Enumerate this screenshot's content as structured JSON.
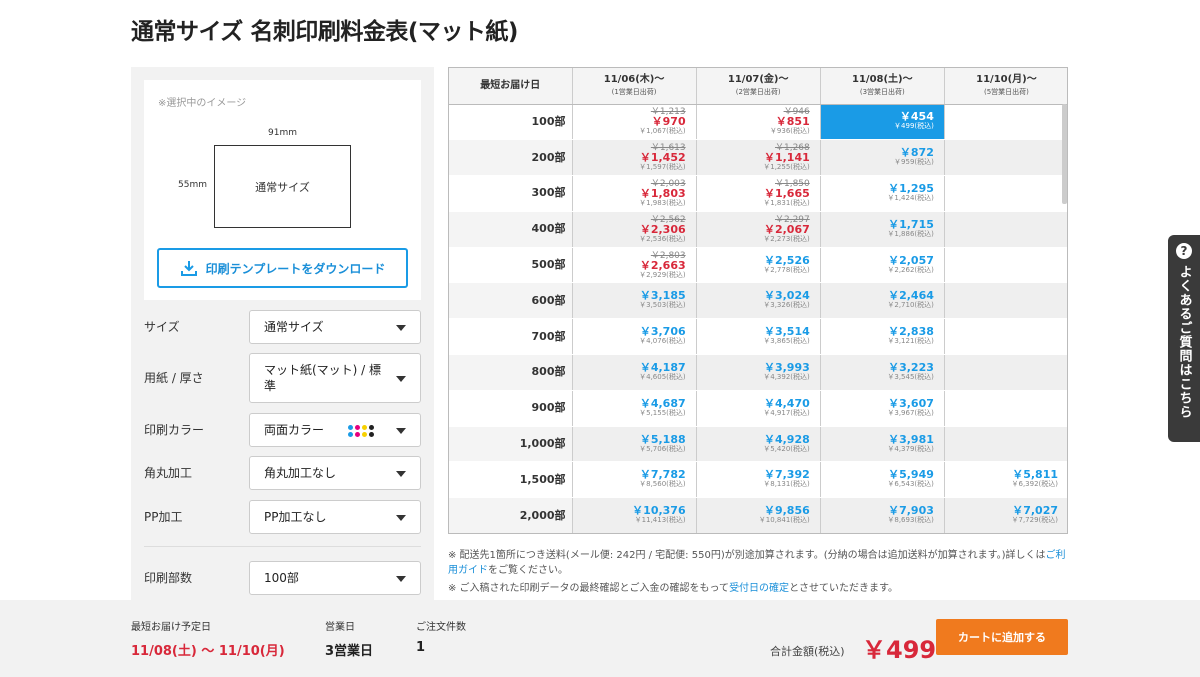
{
  "title": "通常サイズ 名刺印刷料金表(マット紙)",
  "preview": {
    "note": "※選択中のイメージ",
    "width": "91mm",
    "height": "55mm",
    "card_label": "通常サイズ",
    "download_button": "印刷テンプレートをダウンロード"
  },
  "options": [
    {
      "label": "サイズ",
      "value": "通常サイズ"
    },
    {
      "label": "用紙 / 厚さ",
      "value": "マット紙(マット) / 標準"
    },
    {
      "label": "印刷カラー",
      "value": "両面カラー"
    },
    {
      "label": "角丸加工",
      "value": "角丸加工なし"
    },
    {
      "label": "PP加工",
      "value": "PP加工なし"
    },
    {
      "label": "印刷部数",
      "value": "100部"
    }
  ],
  "color_dots": [
    "#1a9be6",
    "#e5007f",
    "#f7d100",
    "#222222",
    "#1a9be6",
    "#e5007f",
    "#f7d100",
    "#222222"
  ],
  "table": {
    "corner": "最短お届け日",
    "columns": [
      {
        "date": "11/06(木)〜",
        "sub": "(1営業日出荷)"
      },
      {
        "date": "11/07(金)〜",
        "sub": "(2営業日出荷)"
      },
      {
        "date": "11/08(土)〜",
        "sub": "(3営業日出荷)"
      },
      {
        "date": "11/10(月)〜",
        "sub": "(5営業日出荷)"
      }
    ],
    "rows": [
      {
        "qty": "100部",
        "cells": [
          {
            "old": "￥1,213",
            "price": "￥970",
            "tax": "￥1,067(税込)",
            "color": "red"
          },
          {
            "old": "￥946",
            "price": "￥851",
            "tax": "￥936(税込)",
            "color": "red"
          },
          {
            "old": "",
            "price": "￥454",
            "tax": "￥499(税込)",
            "color": "blue",
            "selected": true
          },
          {
            "old": "",
            "price": "",
            "tax": "",
            "color": "blue"
          }
        ]
      },
      {
        "qty": "200部",
        "cells": [
          {
            "old": "￥1,613",
            "price": "￥1,452",
            "tax": "￥1,597(税込)",
            "color": "red"
          },
          {
            "old": "￥1,268",
            "price": "￥1,141",
            "tax": "￥1,255(税込)",
            "color": "red"
          },
          {
            "old": "",
            "price": "￥872",
            "tax": "￥959(税込)",
            "color": "blue"
          },
          {
            "old": "",
            "price": "",
            "tax": "",
            "color": "blue"
          }
        ]
      },
      {
        "qty": "300部",
        "cells": [
          {
            "old": "￥2,003",
            "price": "￥1,803",
            "tax": "￥1,983(税込)",
            "color": "red"
          },
          {
            "old": "￥1,850",
            "price": "￥1,665",
            "tax": "￥1,831(税込)",
            "color": "red"
          },
          {
            "old": "",
            "price": "￥1,295",
            "tax": "￥1,424(税込)",
            "color": "blue"
          },
          {
            "old": "",
            "price": "",
            "tax": "",
            "color": "blue"
          }
        ]
      },
      {
        "qty": "400部",
        "cells": [
          {
            "old": "￥2,562",
            "price": "￥2,306",
            "tax": "￥2,536(税込)",
            "color": "red"
          },
          {
            "old": "￥2,297",
            "price": "￥2,067",
            "tax": "￥2,273(税込)",
            "color": "red"
          },
          {
            "old": "",
            "price": "￥1,715",
            "tax": "￥1,886(税込)",
            "color": "blue"
          },
          {
            "old": "",
            "price": "",
            "tax": "",
            "color": "blue"
          }
        ]
      },
      {
        "qty": "500部",
        "cells": [
          {
            "old": "￥2,803",
            "price": "￥2,663",
            "tax": "￥2,929(税込)",
            "color": "red"
          },
          {
            "old": "",
            "price": "￥2,526",
            "tax": "￥2,778(税込)",
            "color": "blue"
          },
          {
            "old": "",
            "price": "￥2,057",
            "tax": "￥2,262(税込)",
            "color": "blue"
          },
          {
            "old": "",
            "price": "",
            "tax": "",
            "color": "blue"
          }
        ]
      },
      {
        "qty": "600部",
        "cells": [
          {
            "old": "",
            "price": "￥3,185",
            "tax": "￥3,503(税込)",
            "color": "blue"
          },
          {
            "old": "",
            "price": "￥3,024",
            "tax": "￥3,326(税込)",
            "color": "blue"
          },
          {
            "old": "",
            "price": "￥2,464",
            "tax": "￥2,710(税込)",
            "color": "blue"
          },
          {
            "old": "",
            "price": "",
            "tax": "",
            "color": "blue"
          }
        ]
      },
      {
        "qty": "700部",
        "cells": [
          {
            "old": "",
            "price": "￥3,706",
            "tax": "￥4,076(税込)",
            "color": "blue"
          },
          {
            "old": "",
            "price": "￥3,514",
            "tax": "￥3,865(税込)",
            "color": "blue"
          },
          {
            "old": "",
            "price": "￥2,838",
            "tax": "￥3,121(税込)",
            "color": "blue"
          },
          {
            "old": "",
            "price": "",
            "tax": "",
            "color": "blue"
          }
        ]
      },
      {
        "qty": "800部",
        "cells": [
          {
            "old": "",
            "price": "￥4,187",
            "tax": "￥4,605(税込)",
            "color": "blue"
          },
          {
            "old": "",
            "price": "￥3,993",
            "tax": "￥4,392(税込)",
            "color": "blue"
          },
          {
            "old": "",
            "price": "￥3,223",
            "tax": "￥3,545(税込)",
            "color": "blue"
          },
          {
            "old": "",
            "price": "",
            "tax": "",
            "color": "blue"
          }
        ]
      },
      {
        "qty": "900部",
        "cells": [
          {
            "old": "",
            "price": "￥4,687",
            "tax": "￥5,155(税込)",
            "color": "blue"
          },
          {
            "old": "",
            "price": "￥4,470",
            "tax": "￥4,917(税込)",
            "color": "blue"
          },
          {
            "old": "",
            "price": "￥3,607",
            "tax": "￥3,967(税込)",
            "color": "blue"
          },
          {
            "old": "",
            "price": "",
            "tax": "",
            "color": "blue"
          }
        ]
      },
      {
        "qty": "1,000部",
        "cells": [
          {
            "old": "",
            "price": "￥5,188",
            "tax": "￥5,706(税込)",
            "color": "blue"
          },
          {
            "old": "",
            "price": "￥4,928",
            "tax": "￥5,420(税込)",
            "color": "blue"
          },
          {
            "old": "",
            "price": "￥3,981",
            "tax": "￥4,379(税込)",
            "color": "blue"
          },
          {
            "old": "",
            "price": "",
            "tax": "",
            "color": "blue"
          }
        ]
      },
      {
        "qty": "1,500部",
        "cells": [
          {
            "old": "",
            "price": "￥7,782",
            "tax": "￥8,560(税込)",
            "color": "blue"
          },
          {
            "old": "",
            "price": "￥7,392",
            "tax": "￥8,131(税込)",
            "color": "blue"
          },
          {
            "old": "",
            "price": "￥5,949",
            "tax": "￥6,543(税込)",
            "color": "blue"
          },
          {
            "old": "",
            "price": "￥5,811",
            "tax": "￥6,392(税込)",
            "color": "blue"
          }
        ]
      },
      {
        "qty": "2,000部",
        "cells": [
          {
            "old": "",
            "price": "￥10,376",
            "tax": "￥11,413(税込)",
            "color": "blue"
          },
          {
            "old": "",
            "price": "￥9,856",
            "tax": "￥10,841(税込)",
            "color": "blue"
          },
          {
            "old": "",
            "price": "￥7,903",
            "tax": "￥8,693(税込)",
            "color": "blue"
          },
          {
            "old": "",
            "price": "￥7,027",
            "tax": "￥7,729(税込)",
            "color": "blue"
          }
        ]
      }
    ]
  },
  "notes": {
    "shipping_a": "※ 配送先1箇所につき送料(メール便: 242円 / 宅配便: 550円)が別途加算されます。(分納の場合は追加送料が加算されます。)詳しくは",
    "shipping_link": "ご利用ガイド",
    "shipping_b": "をご覧ください。",
    "confirm_a": "※ ご入稿された印刷データの最終確認とご入金の確認をもって",
    "confirm_link": "受付日の確定",
    "confirm_b": "とさせていただきます。"
  },
  "faq": "よくあるご質問はこちら",
  "footer": {
    "delivery_label": "最短お届け予定日",
    "delivery_value": "11/08(土) 〜 11/10(月)",
    "days_label": "営業日",
    "days_value": "3営業日",
    "count_label": "ご注文件数",
    "count_value": "1",
    "total_label": "合計金額(税込)",
    "total_value": "￥499",
    "cart_button": "カートに追加する"
  },
  "colors": {
    "accent_blue": "#1a9be6",
    "price_red": "#d8283a",
    "cart_orange": "#f07a1e"
  }
}
